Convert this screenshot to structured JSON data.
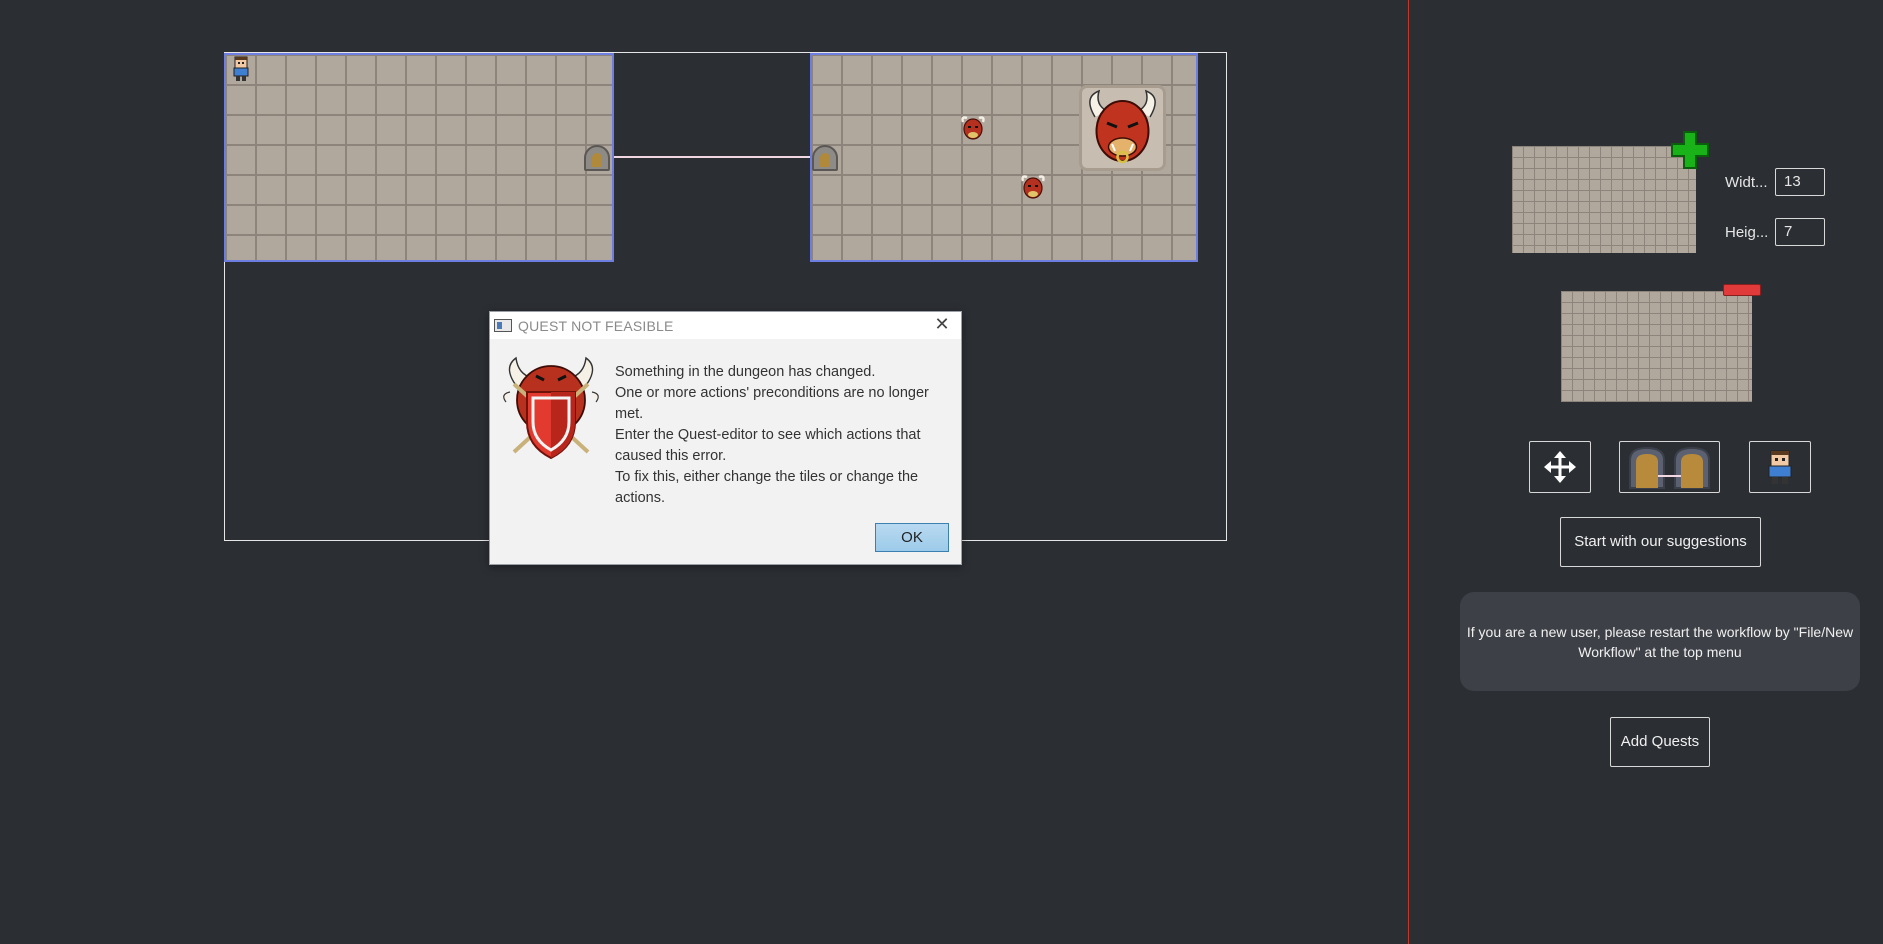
{
  "dialog": {
    "title": "QUEST NOT FEASIBLE",
    "close_glyph": "✕",
    "emblem_icon": "minotaur-shield-icon",
    "message_lines": [
      "Something in the dungeon has changed.",
      "One or more actions' preconditions are no longer met.",
      "Enter the Quest-editor to see which actions that caused this error.",
      "To fix this, either change the tiles or change the actions."
    ],
    "ok_label": "OK"
  },
  "dungeon": {
    "rooms": [
      {
        "name": "room-a",
        "icons": [
          "hero-icon",
          "door-icon"
        ]
      },
      {
        "name": "room-b",
        "icons": [
          "door-icon",
          "minotaur-icon",
          "minotaur-icon",
          "minotaur-boss-icon"
        ]
      }
    ],
    "connector_color": "#f0d7e2",
    "room_border_color": "#6d7ee0"
  },
  "side_panel": {
    "add_room_icon": "green-plus-icon",
    "remove_room_icon": "red-minus-icon",
    "width_label": "Widt...",
    "width_value": "13",
    "height_label": "Heig...",
    "height_value": "7",
    "tools": [
      "move-icon",
      "connect-doors-icon",
      "hero-icon"
    ],
    "suggestions_button": "Start with our suggestions",
    "info_text": "If you are a new user, please restart the workflow by \"File/New Workflow\" at the top menu",
    "add_quests_button": "Add Quests",
    "divider_color": "#c0392b"
  }
}
